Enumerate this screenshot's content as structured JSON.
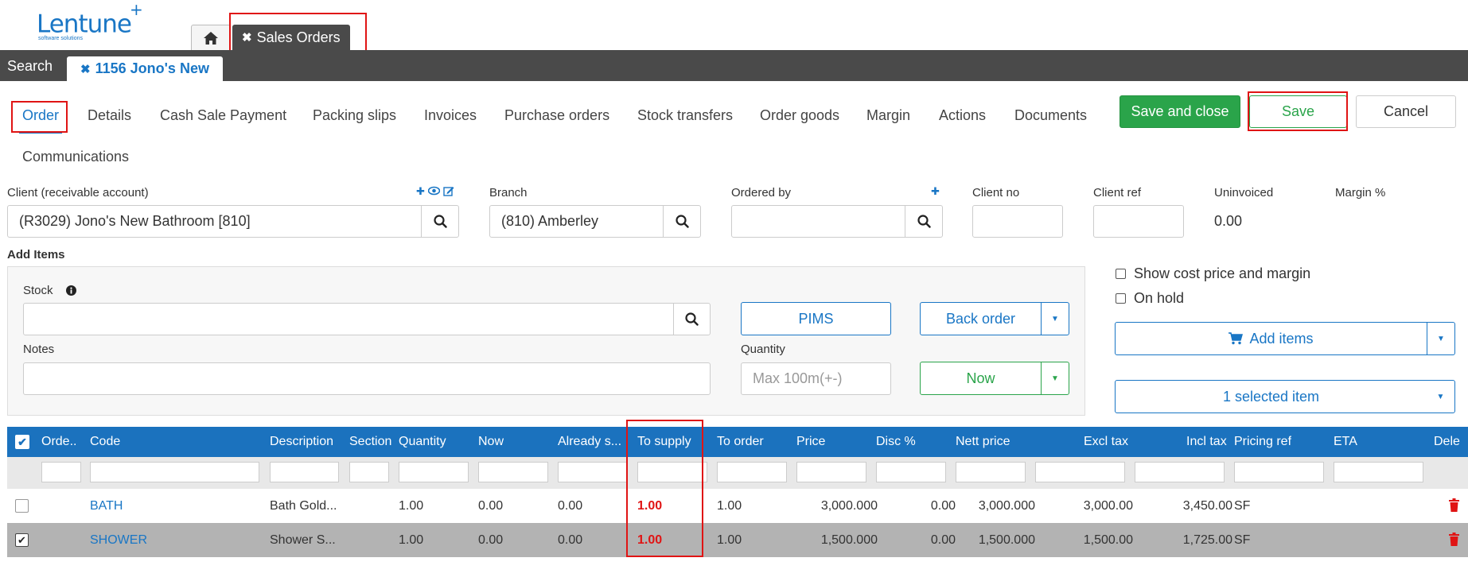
{
  "app": {
    "logo_text": "Lentune",
    "logo_plus": "+",
    "logo_sub": "software solutions"
  },
  "top_tabs": {
    "home_icon": "home-icon",
    "sales_orders": "Sales Orders"
  },
  "bar": {
    "search": "Search",
    "order_tab": "1156 Jono's New"
  },
  "nav": {
    "items": [
      "Order",
      "Details",
      "Cash Sale Payment",
      "Packing slips",
      "Invoices",
      "Purchase orders",
      "Stock transfers",
      "Order goods",
      "Margin",
      "Actions",
      "Documents",
      "Communications"
    ],
    "active": "Order"
  },
  "actions": {
    "save_and_close": "Save and close",
    "save": "Save",
    "cancel": "Cancel"
  },
  "form": {
    "client_label": "Client (receivable account)",
    "client_value": "(R3029) Jono's New Bathroom [810]",
    "branch_label": "Branch",
    "branch_value": "(810) Amberley",
    "ordered_by_label": "Ordered by",
    "ordered_by_value": "",
    "client_no_label": "Client no",
    "client_ref_label": "Client ref",
    "uninvoiced_label": "Uninvoiced",
    "uninvoiced_value": "0.00",
    "margin_label": "Margin %"
  },
  "add_items": {
    "title": "Add Items",
    "stock_label": "Stock",
    "notes_label": "Notes",
    "quantity_label": "Quantity",
    "quantity_placeholder": "Max 100m(+-)",
    "pims": "PIMS",
    "back_order": "Back order",
    "now": "Now",
    "show_cost": "Show cost price and margin",
    "on_hold": "On hold",
    "add_items_btn": "Add items",
    "selected": "1 selected item"
  },
  "table": {
    "columns": [
      "Orde...",
      "Code",
      "Description",
      "Section",
      "Quantity",
      "Now",
      "Already s...",
      "To supply",
      "To order",
      "Price",
      "Disc %",
      "Nett price",
      "Excl tax",
      "Incl tax",
      "Pricing ref",
      "ETA",
      "Dele"
    ],
    "rows": [
      {
        "checked": false,
        "code": "BATH",
        "description": "Bath Gold...",
        "section": "",
        "quantity": "1.00",
        "now": "0.00",
        "already": "0.00",
        "to_supply": "1.00",
        "to_order": "1.00",
        "price": "3,000.000",
        "disc": "0.00",
        "nett": "3,000.000",
        "excl": "3,000.00",
        "incl": "3,450.00",
        "pricing_ref": "SF",
        "eta": ""
      },
      {
        "checked": true,
        "code": "SHOWER",
        "description": "Shower S...",
        "section": "",
        "quantity": "1.00",
        "now": "0.00",
        "already": "0.00",
        "to_supply": "1.00",
        "to_order": "1.00",
        "price": "1,500.000",
        "disc": "0.00",
        "nett": "1,500.000",
        "excl": "1,500.00",
        "incl": "1,725.00",
        "pricing_ref": "SF",
        "eta": ""
      }
    ]
  },
  "colors": {
    "brand_blue": "#1976c5",
    "header_dark": "#4a4a4a",
    "green": "#2aa44a",
    "highlight_red": "#e01414"
  }
}
